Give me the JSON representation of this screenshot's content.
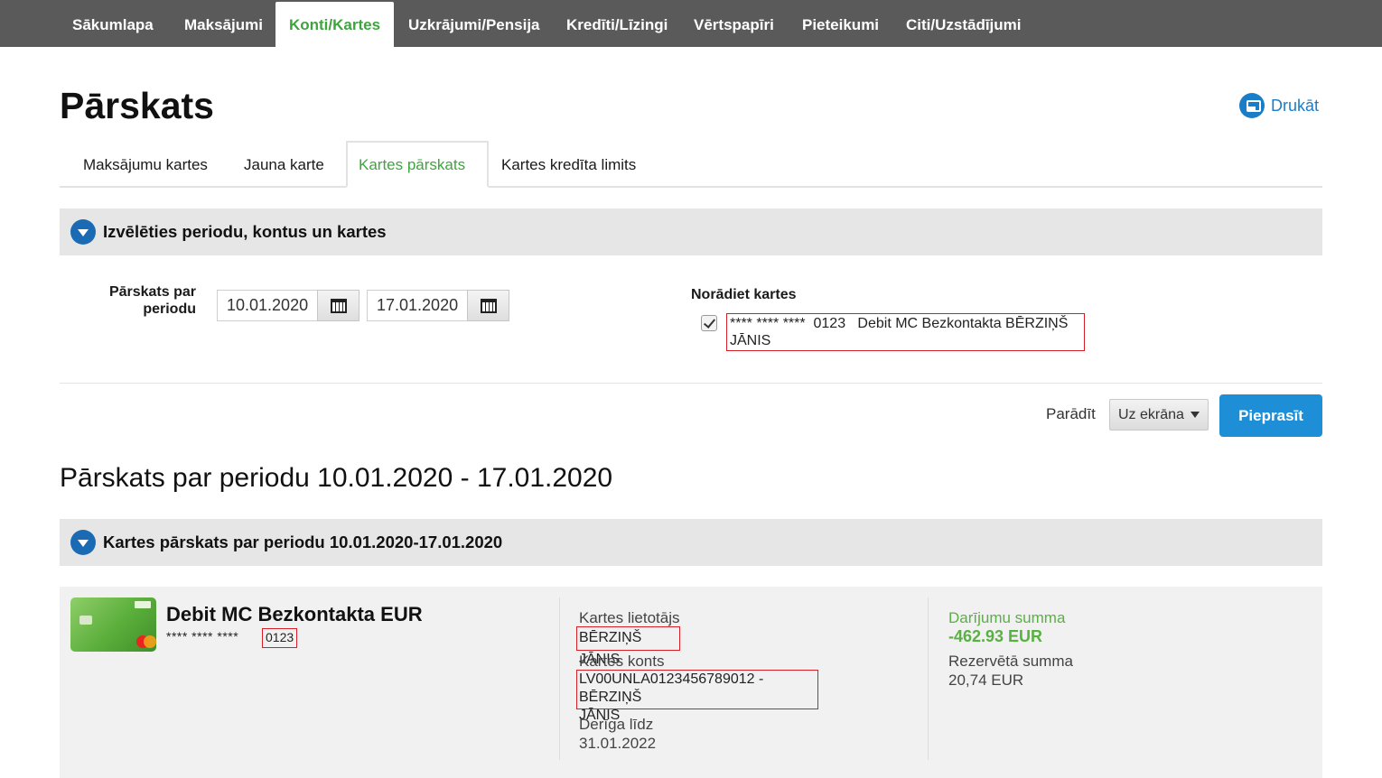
{
  "nav": {
    "items": [
      "Sākumlapa",
      "Maksājumi",
      "Konti/Kartes",
      "Uzkrājumi/Pensija",
      "Kredīti/Līzingi",
      "Vērtspapīri",
      "Pieteikumi",
      "Citi/Uzstādījumi"
    ],
    "active": "Konti/Kartes"
  },
  "page": {
    "title": "Pārskats",
    "print_label": "Drukāt",
    "print_icon": "printer-icon"
  },
  "subtabs": {
    "items": [
      "Maksājumu kartes",
      "Jauna karte",
      "Kartes pārskats",
      "Kartes kredīta limits"
    ],
    "active": "Kartes pārskats"
  },
  "filter": {
    "section_title": "Izvēlēties periodu, kontus un kartes",
    "period_label_line1": "Pārskats par",
    "period_label_line2": "periodu",
    "date_from": "10.01.2020",
    "date_to": "17.01.2020",
    "cards_label": "Norādiet kartes",
    "card_option_checked": true,
    "card_option_line1": "**** **** ****  0123   Debit MC Bezkontakta BĒRZIŅŠ",
    "card_option_line2": "JĀNIS",
    "show_label": "Parādīt",
    "show_value": "Uz ekrāna",
    "request_button": "Pieprasīt"
  },
  "report": {
    "heading": "Pārskats par periodu 10.01.2020 - 17.01.2020",
    "section_title": "Kartes pārskats par periodu 10.01.2020-17.01.2020"
  },
  "card": {
    "name": "Debit MC Bezkontakta EUR",
    "mask": "**** **** ****",
    "last4": "0123",
    "user_label": "Kartes lietotājs",
    "user_value": "BĒRZIŅŠ JĀNIS",
    "account_label": "Kartes konts",
    "account_line1": "LV00UNLA0123456789012 - BĒRZIŅŠ",
    "account_line2": "JĀNIS",
    "valid_label": "Derīga līdz",
    "valid_value": "31.01.2022",
    "tx_sum_label": "Darījumu summa",
    "tx_sum_value": "-462.93 EUR",
    "reserved_label": "Rezervētā summa",
    "reserved_value": "20,74 EUR"
  },
  "colors": {
    "nav_bg": "#5a5a5a",
    "accent_green": "#3ea53e",
    "accent_blue": "#1e8fd6",
    "highlight_red": "#d61f26"
  }
}
